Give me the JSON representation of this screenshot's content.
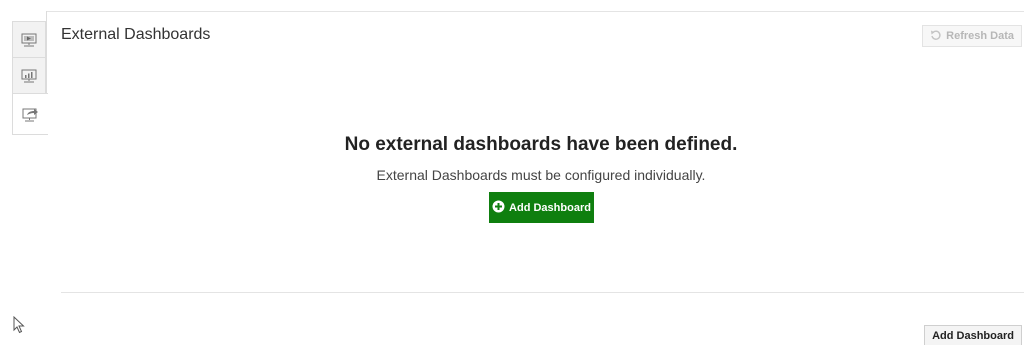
{
  "page": {
    "title": "External Dashboards"
  },
  "toolbar": {
    "refresh_label": "Refresh Data",
    "refresh_icon": "refresh-icon"
  },
  "sidebar": {
    "tabs": [
      {
        "icon": "monitor-play-icon"
      },
      {
        "icon": "monitor-chart-icon"
      },
      {
        "icon": "monitor-share-icon",
        "active": true
      }
    ]
  },
  "empty_state": {
    "heading": "No external dashboards have been defined.",
    "subtext": "External Dashboards must be configured individually.",
    "add_button_label": "Add Dashboard",
    "add_button_icon": "plus-circle-icon"
  },
  "footer": {
    "add_button_label": "Add Dashboard"
  },
  "colors": {
    "primary_button": "#0f7f0f",
    "disabled_text": "#b7b7b7"
  }
}
